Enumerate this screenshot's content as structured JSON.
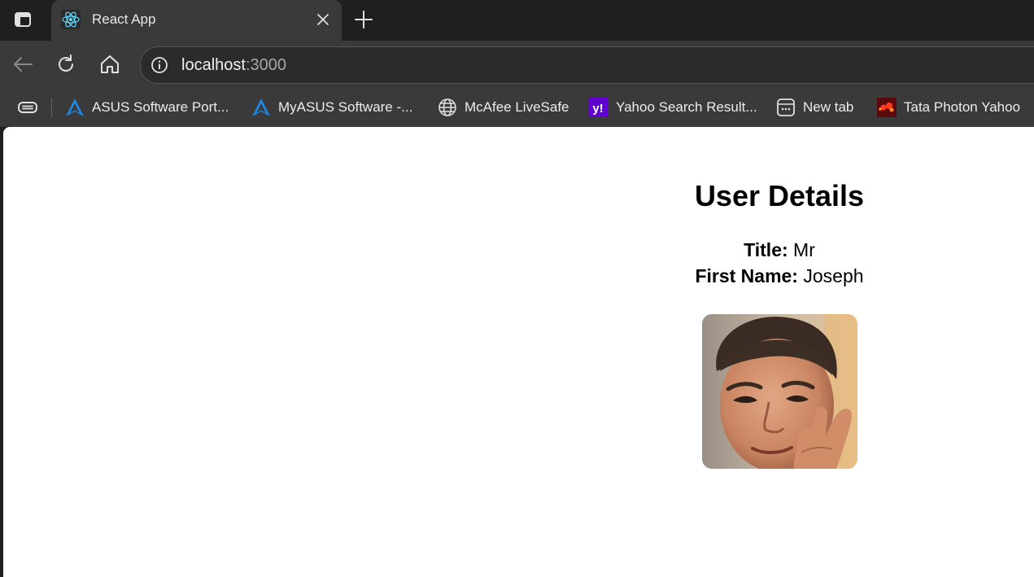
{
  "browser": {
    "tab": {
      "title": "React App"
    },
    "address": {
      "host": "localhost",
      "port": ":3000"
    },
    "bookmarks": [
      {
        "label": "ASUS Software Port...",
        "icon": "asus-icon"
      },
      {
        "label": "MyASUS Software -...",
        "icon": "asus-icon"
      },
      {
        "label": "McAfee LiveSafe",
        "icon": "globe-icon"
      },
      {
        "label": "Yahoo Search Result...",
        "icon": "yahoo-icon"
      },
      {
        "label": "New tab",
        "icon": "new-tab-page-icon"
      },
      {
        "label": "Tata Photon Yahoo",
        "icon": "tata-photon-icon"
      }
    ]
  },
  "page": {
    "heading": "User Details",
    "title_label": "Title:",
    "title_value": "Mr",
    "first_name_label": "First Name:",
    "first_name_value": "Joseph",
    "photo_icon": "user-photo"
  },
  "colors": {
    "chrome_dark": "#1f1f1f",
    "chrome_mid": "#3a3a3a",
    "accent_blue": "#1e88e5",
    "yahoo_purple": "#6001d2"
  }
}
